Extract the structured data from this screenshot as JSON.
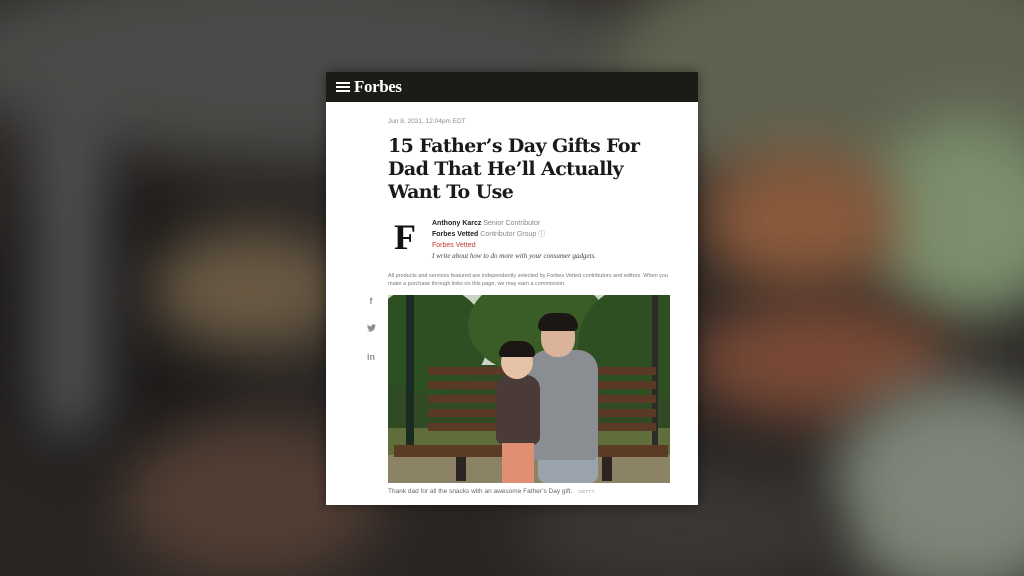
{
  "brand": {
    "logo_text": "Forbes"
  },
  "article": {
    "date": "Jun 8, 2021, 12:04pm EDT",
    "headline": "15 Father’s Day Gifts For Dad That He’ll Actually Want To Use",
    "author": {
      "logo_letter": "F",
      "name": "Anthony Karcz",
      "name_role": "Senior Contributor",
      "group": "Forbes Vetted",
      "group_role": "Contributor Group ⓘ",
      "tag": "Forbes Vetted",
      "bio": "I write about how to do more with your consumer gadgets."
    },
    "disclosure": "All products and services featured are independently selected by Forbes Vetted contributors and editors. When you make a purchase through links on this page, we may earn a commission.",
    "image": {
      "caption": "Thank dad for all the snacks with an awesome Father’s Day gift.",
      "credit": "GETTY"
    }
  },
  "social": {
    "facebook": "f",
    "twitter": "🐦",
    "linkedin": "in"
  },
  "colors": {
    "topbar": "#1d1b18",
    "accent": "#c0392b",
    "background": "#2a2624"
  }
}
